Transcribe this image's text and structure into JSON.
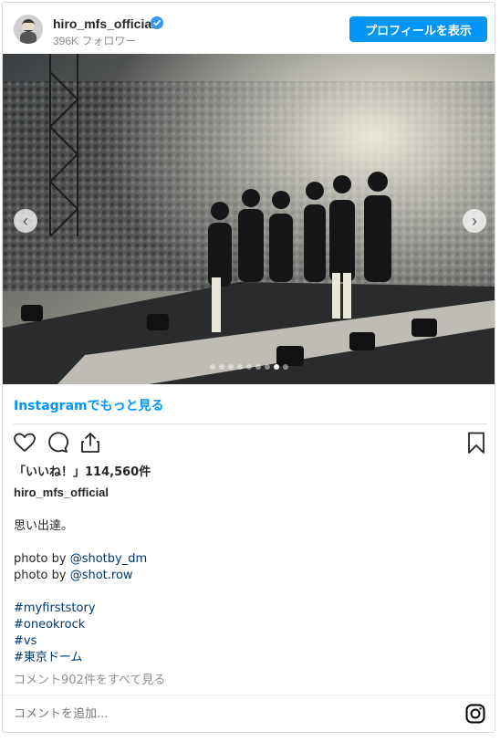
{
  "header": {
    "username": "hiro_mfs_official",
    "followers": "396K フォロワー",
    "profile_button": "プロフィールを表示"
  },
  "photo": {
    "alt": "",
    "carousel_total": 9,
    "carousel_active": 7
  },
  "more_link": "Instagramでもっと見る",
  "actions": {
    "like_icon": "heart-icon",
    "comment_icon": "comment-icon",
    "share_icon": "share-icon",
    "save_icon": "bookmark-icon"
  },
  "likes": "「いいね！」114,560件",
  "caption": {
    "username": "hiro_mfs_official",
    "text": "思い出達。",
    "photo_credit_1_prefix": "photo by ",
    "photo_credit_1_handle": "@shotby_dm",
    "photo_credit_2_prefix": "photo by ",
    "photo_credit_2_handle": "@shot.row",
    "hashtags": [
      "#myfirststory",
      "#oneokrock",
      "#vs",
      "#東京ドーム"
    ]
  },
  "view_comments": "コメント902件をすべて見る",
  "comment_placeholder": "コメントを追加...",
  "colors": {
    "accent": "#0095f6",
    "link": "#00376b",
    "muted": "#8e8e8e",
    "verified": "#3897f0"
  }
}
